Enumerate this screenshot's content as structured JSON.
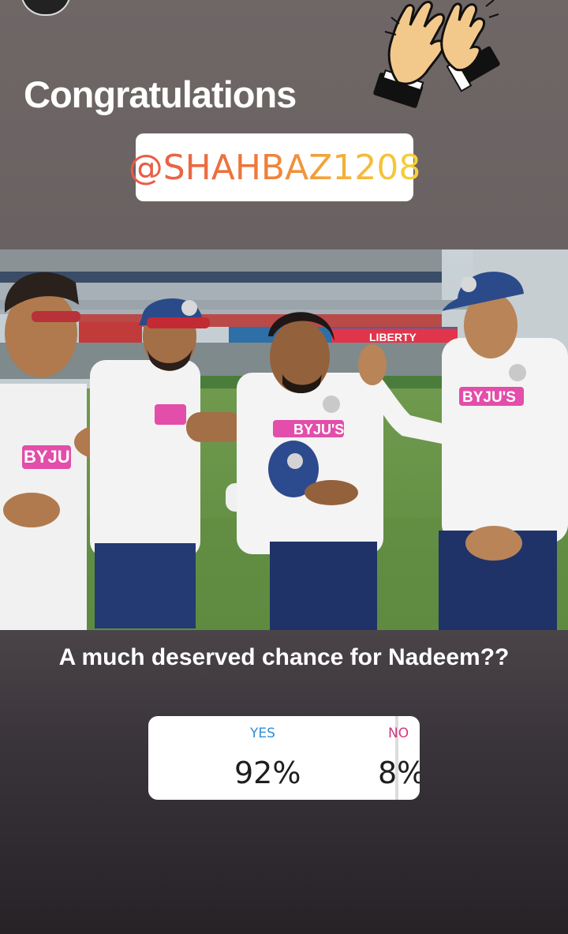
{
  "story": {
    "heading": "Congratulations",
    "mention": "@SHAHBAZ1208"
  },
  "poll": {
    "question": "A much deserved chance for Nadeem??",
    "options": [
      {
        "label": "YES",
        "percent_text": "92%",
        "percent": 92,
        "color": "#2f8ed8"
      },
      {
        "label": "NO",
        "percent_text": "8%",
        "percent": 8,
        "color": "#d3357f"
      }
    ]
  },
  "photo": {
    "jersey_text": "BYJU'S",
    "stand_banner": "LIBERTY"
  },
  "icons": {
    "sticker": "clapping-hands-icon",
    "profile": "avatar"
  }
}
